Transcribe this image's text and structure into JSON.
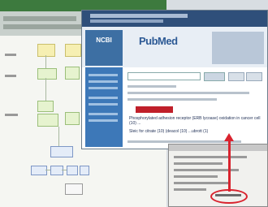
{
  "pubmed": {
    "ncbi_logo": "NCBI",
    "brand": "PubMed",
    "citations": [
      "Phosphorylated adhesion receptor (ERB lycoase) oxidation in cancer cell (10) ...",
      "Sleic for citrate (10) (deacol (10) ...ubrott (1)"
    ]
  },
  "colors": {
    "ncbi_blue": "#2f4f7a",
    "sidebar_blue": "#3d78b8",
    "annotation_red": "#d9232e",
    "diagram_green": "#3d7a3e"
  }
}
